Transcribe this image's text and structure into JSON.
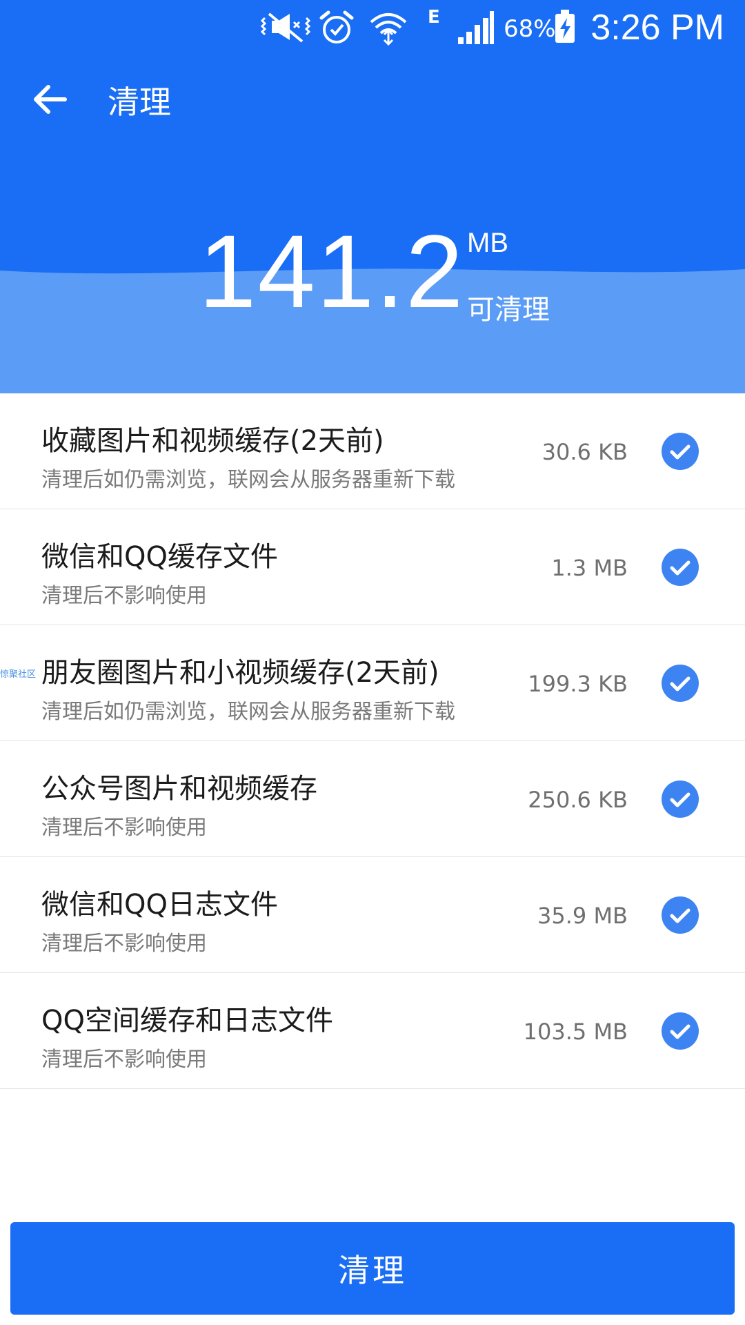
{
  "status_bar": {
    "battery": "68%",
    "time": "3:26 PM",
    "network_type": "E",
    "icons": [
      "vibrate-icon",
      "alarm-icon",
      "wifi-icon",
      "network-type-icon",
      "signal-icon",
      "battery-charging-icon"
    ]
  },
  "app_bar": {
    "back_icon": "arrow-left-icon",
    "title": "清理"
  },
  "summary": {
    "amount": "141.2",
    "unit": "MB",
    "label": "可清理"
  },
  "watermark": "惊聚社区",
  "items": [
    {
      "title": "收藏图片和视频缓存(2天前)",
      "desc": "清理后如仍需浏览，联网会从服务器重新下载",
      "size": "30.6 KB",
      "checked": true
    },
    {
      "title": "微信和QQ缓存文件",
      "desc": "清理后不影响使用",
      "size": "1.3 MB",
      "checked": true
    },
    {
      "title": "朋友圈图片和小视频缓存(2天前)",
      "desc": "清理后如仍需浏览，联网会从服务器重新下载",
      "size": "199.3 KB",
      "checked": true
    },
    {
      "title": "公众号图片和视频缓存",
      "desc": "清理后不影响使用",
      "size": "250.6 KB",
      "checked": true
    },
    {
      "title": "微信和QQ日志文件",
      "desc": "清理后不影响使用",
      "size": "35.9 MB",
      "checked": true
    },
    {
      "title": "QQ空间缓存和日志文件",
      "desc": "清理后不影响使用",
      "size": "103.5 MB",
      "checked": true
    }
  ],
  "clean_button": {
    "label": "清理"
  },
  "colors": {
    "primary": "#1a6ef5",
    "wave": "#5b9cf6",
    "check": "#3d84f2",
    "divider": "#e3e3e3"
  }
}
